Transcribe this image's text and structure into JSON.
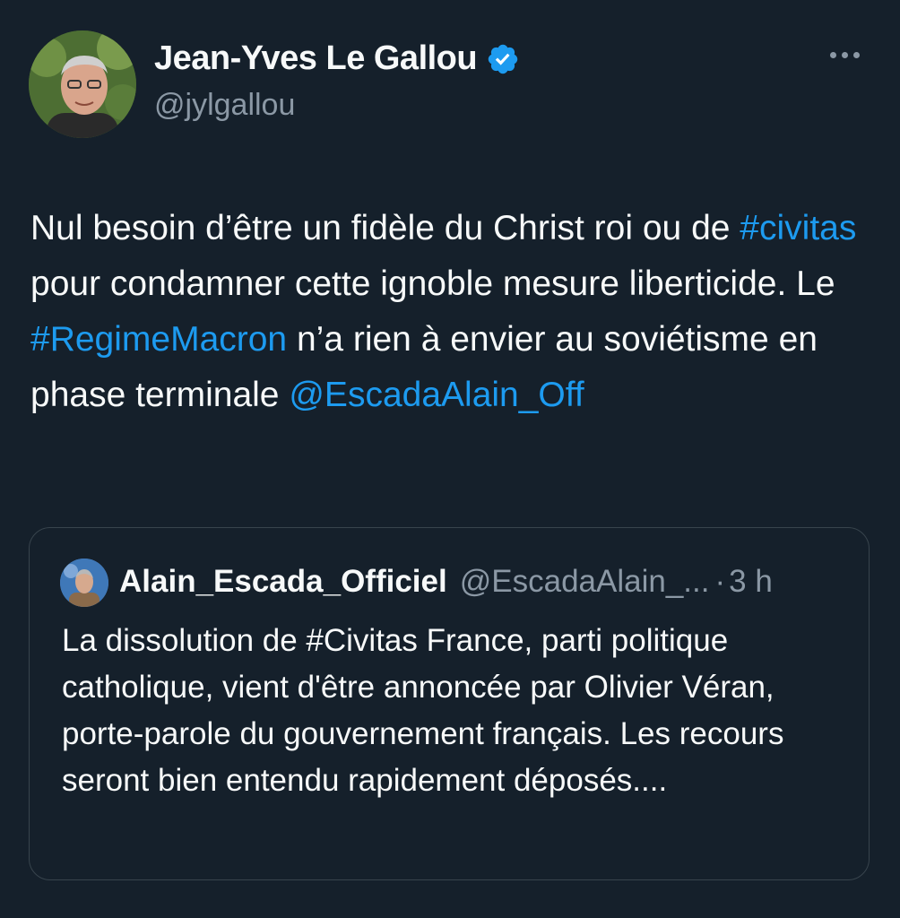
{
  "author": {
    "display_name": "Jean-Yves Le Gallou",
    "handle": "@jylgallou",
    "verified_icon": "verified-badge-icon",
    "avatar_icon": "profile-photo"
  },
  "more_icon": "more-options-icon",
  "tweet": {
    "t1": "Nul besoin d’être un fidèle du Christ roi ou de ",
    "l1": "#civitas",
    "t2": " pour  condamner cette ignoble mesure liberticide. Le ",
    "l2": "#RegimeMacron",
    "t3": " n’a rien à envier au soviétisme  en phase terminale ",
    "l3": "@EscadaAlain_Off"
  },
  "quoted": {
    "display_name": "Alain_Escada_Officiel",
    "handle": "@EscadaAlain_...",
    "separator": "·",
    "time": "3 h",
    "text": "La dissolution de #Civitas France, parti politique catholique, vient d'être annoncée par Olivier Véran, porte-parole du gouvernement français. Les recours seront bien entendu rapidement déposés...."
  },
  "colors": {
    "background": "#15202b",
    "link": "#1d9bf0",
    "muted": "#8b98a5",
    "text": "#f7f9f9",
    "border": "#38444d"
  }
}
